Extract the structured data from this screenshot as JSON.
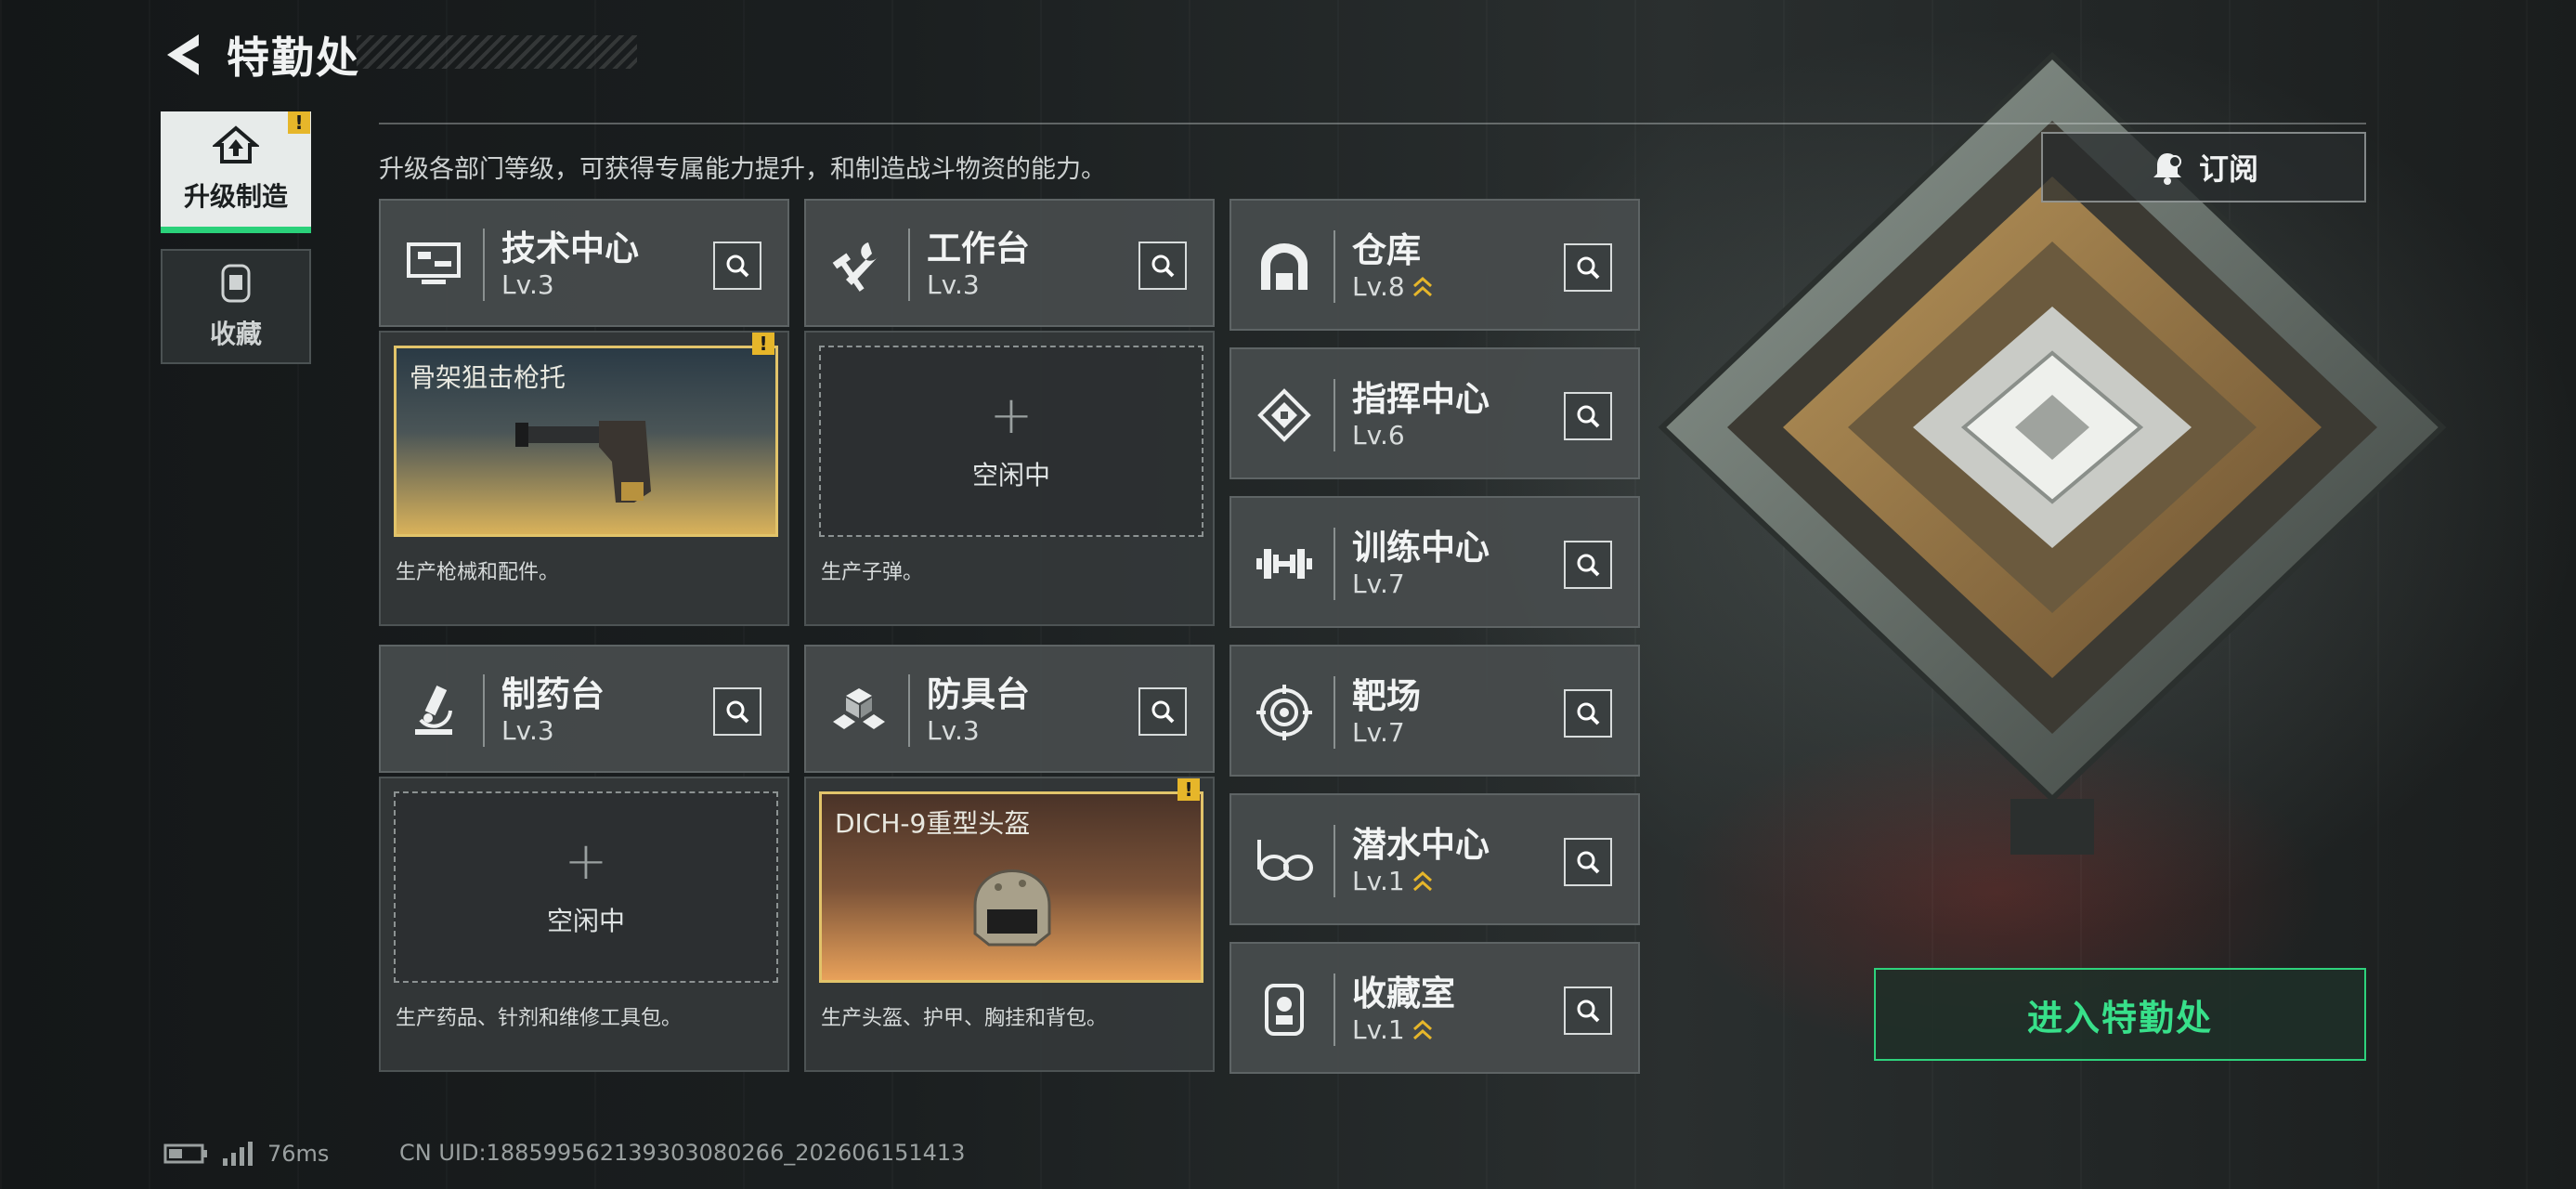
{
  "header": {
    "title": "特勤处"
  },
  "nav": {
    "tabs": [
      {
        "label": "升级制造",
        "active": true,
        "warn": "!"
      },
      {
        "label": "收藏",
        "active": false
      }
    ]
  },
  "subtitle": "升级各部门等级，可获得专属能力提升，和制造战斗物资的能力。",
  "subscribe": {
    "label": "订阅"
  },
  "departments": [
    {
      "name": "技术中心",
      "level": "Lv.3",
      "slot": {
        "state": "busy",
        "item": "骨架狙击枪托",
        "warn": "!"
      },
      "desc": "生产枪械和配件。"
    },
    {
      "name": "工作台",
      "level": "Lv.3",
      "slot": {
        "state": "idle",
        "idle_label": "空闲中"
      },
      "desc": "生产子弹。"
    },
    {
      "name": "制药台",
      "level": "Lv.3",
      "slot": {
        "state": "idle",
        "idle_label": "空闲中"
      },
      "desc": "生产药品、针剂和维修工具包。"
    },
    {
      "name": "防具台",
      "level": "Lv.3",
      "slot": {
        "state": "busy",
        "item": "DICH-9重型头盔",
        "warn": "!"
      },
      "desc": "生产头盔、护甲、胸挂和背包。"
    }
  ],
  "facilities": [
    {
      "name": "仓库",
      "level": "Lv.8",
      "upgradable": true
    },
    {
      "name": "指挥中心",
      "level": "Lv.6",
      "upgradable": false
    },
    {
      "name": "训练中心",
      "level": "Lv.7",
      "upgradable": false
    },
    {
      "name": "靶场",
      "level": "Lv.7",
      "upgradable": false
    },
    {
      "name": "潜水中心",
      "level": "Lv.1",
      "upgradable": true
    },
    {
      "name": "收藏室",
      "level": "Lv.1",
      "upgradable": true
    }
  ],
  "enter_button": {
    "label": "进入特勤处"
  },
  "status": {
    "ping": "76ms",
    "uid": "CN UID:1885995621393030802​66_202606151413"
  },
  "colors": {
    "accent_green": "#2ed27c",
    "warn_yellow": "#e6b62a",
    "gold": "#e2c46a"
  }
}
